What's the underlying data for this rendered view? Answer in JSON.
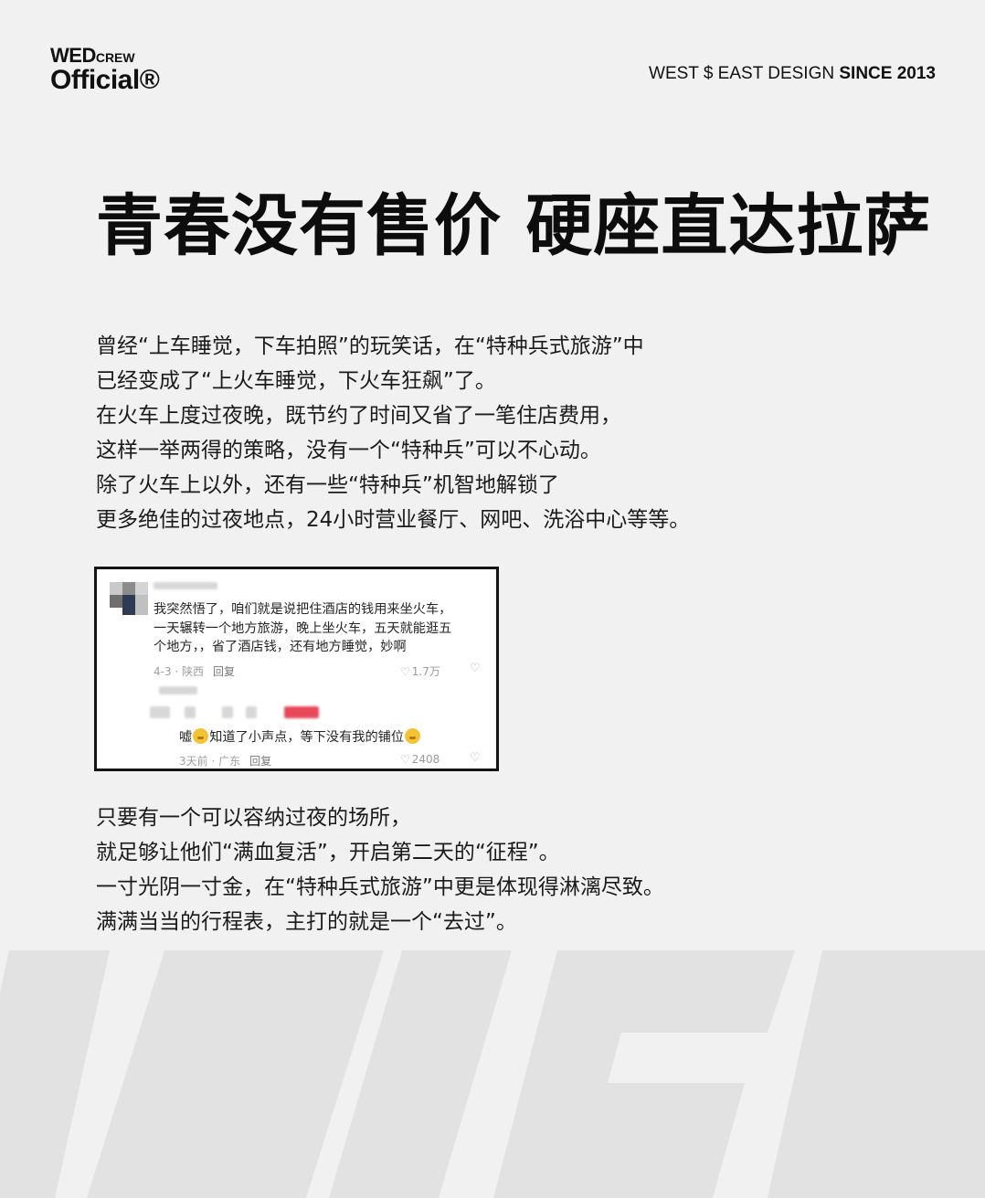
{
  "brand": {
    "logo_line1": "WED",
    "logo_line1_small": "CREW",
    "logo_line2": "Official®",
    "tagline_regular": "WEST $ EAST DESIGN ",
    "tagline_bold": "SINCE 2013"
  },
  "title": "青春没有售价 硬座直达拉萨",
  "intro_lines": [
    "曾经“上车睡觉，下车拍照”的玩笑话，在“特种兵式旅游”中",
    "已经变成了“上火车睡觉，下火车狂飙”了。",
    "在火车上度过夜晚，既节约了时间又省了一笔住店费用，",
    "这样一举两得的策略，没有一个“特种兵”可以不心动。",
    "除了火车上以外，还有一些“特种兵”机智地解锁了",
    "更多绝佳的过夜地点，24小时营业餐厅、网吧、洗浴中心等等。"
  ],
  "screenshot": {
    "comment_lines": [
      "我突然悟了，咱们就是说把住酒店的钱用来坐火车，",
      "一天辗转一个地方旅游，晚上坐火车，五天就能逛五",
      "个地方，，省了酒店钱，还有地方睡觉，妙啊"
    ],
    "comment_meta": "4-3 · 陕西",
    "comment_reply": "回复",
    "comment_likes": "1.7万",
    "reply_before": "嘘",
    "reply_after": "知道了小声点，等下没有我的铺位",
    "reply_meta": "3天前 · 广东",
    "reply_reply": "回复",
    "reply_likes": "2408",
    "heart_glyph": "♡",
    "dislike_glyph": "♡"
  },
  "outro_lines": [
    "只要有一个可以容纳过夜的场所，",
    "就足够让他们“满血复活”，开启第二天的“征程”。",
    "一寸光阴一寸金，在“特种兵式旅游”中更是体现得淋漓尽致。",
    "满满当当的行程表，主打的就是一个“去过”。"
  ],
  "colors": {
    "background": "#f1f1f1",
    "watermark": "#e3e3e3",
    "text": "#1b1b1b"
  }
}
